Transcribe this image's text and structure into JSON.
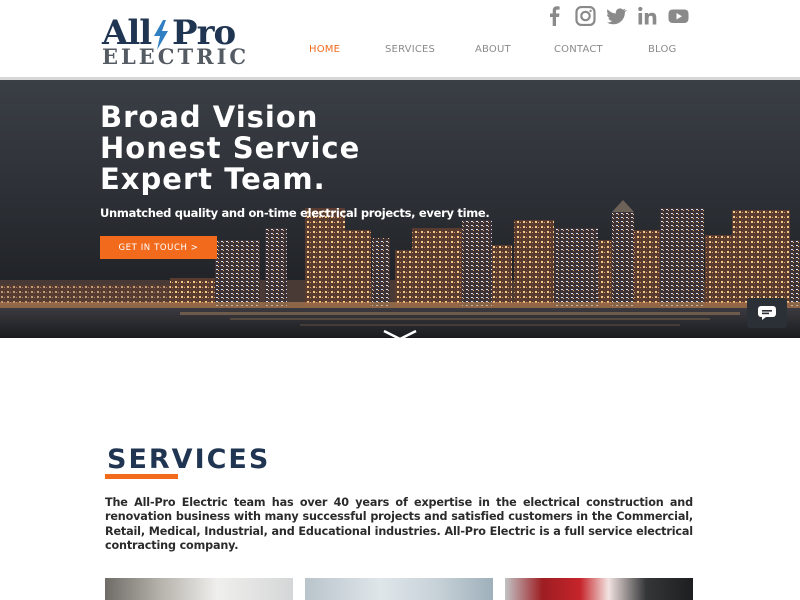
{
  "brand": {
    "logo_top_left": "All",
    "logo_top_right": "Pro",
    "logo_bottom": "ELECTRIC",
    "primary_color": "#1f3552",
    "accent_color": "#f26b1d"
  },
  "social": [
    {
      "icon": "facebook-icon"
    },
    {
      "icon": "instagram-icon"
    },
    {
      "icon": "twitter-icon"
    },
    {
      "icon": "linkedin-icon"
    },
    {
      "icon": "youtube-icon"
    }
  ],
  "nav": {
    "items": [
      {
        "label": "HOME",
        "active": true
      },
      {
        "label": "SERVICES",
        "active": false
      },
      {
        "label": "ABOUT",
        "active": false
      },
      {
        "label": "CONTACT",
        "active": false
      },
      {
        "label": "BLOG",
        "active": false
      }
    ]
  },
  "hero": {
    "title_lines": [
      "Broad Vision",
      "Honest Service",
      "Expert Team."
    ],
    "subtitle": "Unmatched quality and on-time electrical projects, every time.",
    "cta_label": "GET IN TOUCH >"
  },
  "services": {
    "heading": "SERVICES",
    "description": "The All-Pro Electric team has over 40 years of expertise in the electrical construction and renovation business with many successful projects and satisfied customers in the Commercial, Retail, Medical, Industrial, and Educational industries. All-Pro Electric is a full service electrical contracting company."
  }
}
